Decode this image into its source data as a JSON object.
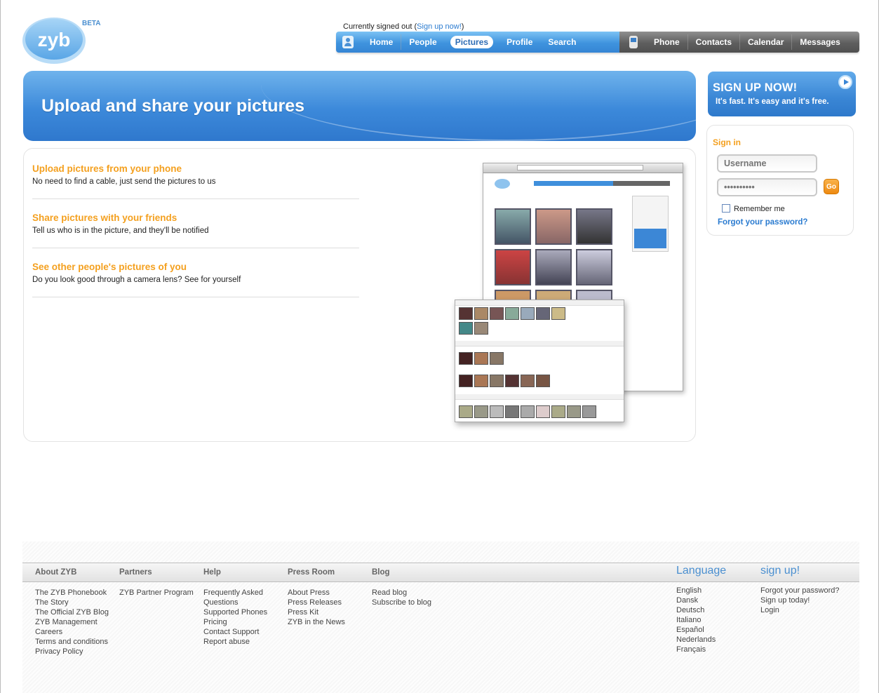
{
  "logo": {
    "text": "zyb",
    "badge": "BETA"
  },
  "header": {
    "status_text": "Currently signed out (",
    "signup_link": "Sign up now!",
    "status_close": ")"
  },
  "nav": {
    "left": [
      "Home",
      "People",
      "Pictures",
      "Profile",
      "Search"
    ],
    "active": "Pictures",
    "right": [
      "Phone",
      "Contacts",
      "Calendar",
      "Messages"
    ]
  },
  "hero": {
    "title": "Upload and share your pictures"
  },
  "features": [
    {
      "title": "Upload pictures from your phone",
      "text": "No need to find a cable, just send the pictures to us"
    },
    {
      "title": "Share pictures with your friends",
      "text": "Tell us who is in the picture, and they'll be notified"
    },
    {
      "title": "See other people's pictures of you",
      "text": "Do you look good through a camera lens? See for yourself"
    }
  ],
  "signup": {
    "title": "SIGN UP NOW!",
    "subtitle": "It's fast. It's easy and it's free."
  },
  "signin": {
    "title": "Sign in",
    "username_placeholder": "Username",
    "password_value": "••••••••••",
    "go_label": "Go",
    "remember_label": "Remember me",
    "forgot_label": "Forgot your password?"
  },
  "footer": {
    "columns": [
      {
        "heading": "About ZYB",
        "links": [
          "The ZYB Phonebook",
          "The Story",
          "The Official ZYB Blog",
          "ZYB Management",
          "Careers",
          "Terms and conditions",
          "Privacy Policy"
        ]
      },
      {
        "heading": "Partners",
        "links": [
          "ZYB Partner Program"
        ]
      },
      {
        "heading": "Help",
        "links": [
          "Frequently Asked",
          "Questions",
          "Supported Phones",
          "Pricing",
          "Contact Support",
          "Report abuse"
        ]
      },
      {
        "heading": "Press Room",
        "links": [
          "About Press",
          "Press Releases",
          "Press Kit",
          "ZYB in the News"
        ]
      },
      {
        "heading": "Blog",
        "links": [
          "Read blog",
          "Subscribe to blog"
        ]
      },
      {
        "heading": "Language",
        "links": [
          "English",
          "Dansk",
          "Deutsch",
          "Italiano",
          "Español",
          "Nederlands",
          "Français"
        ]
      },
      {
        "heading": "sign up!",
        "links": [
          "Forgot your password?",
          "Sign up today!",
          "Login"
        ]
      }
    ]
  },
  "colors": {
    "accent_orange": "#f4a01f",
    "brand_blue": "#3c89da",
    "link_blue": "#2a7bd0"
  }
}
